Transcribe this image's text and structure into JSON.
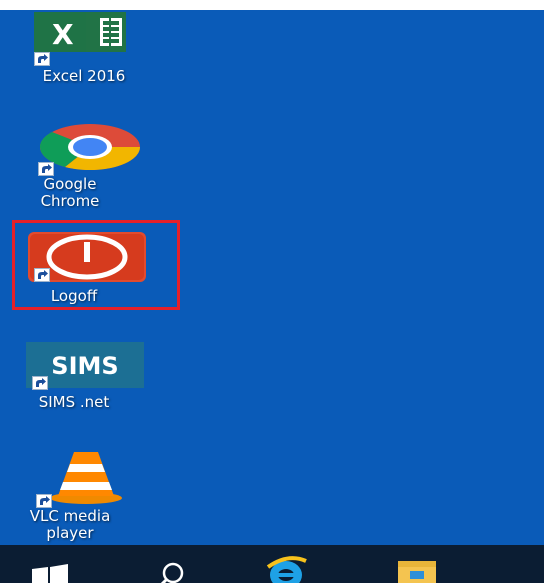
{
  "desktop": {
    "background_color": "#0a5bb8",
    "icons": [
      {
        "label": "Excel 2016",
        "icon": "excel-icon",
        "shortcut": true
      },
      {
        "label": "Google\nChrome",
        "icon": "chrome-icon",
        "shortcut": true
      },
      {
        "label": "Logoff",
        "icon": "power-icon",
        "shortcut": true,
        "selected": true
      },
      {
        "label": "SIMS .net",
        "icon": "sims-icon",
        "icon_text": "SIMS",
        "shortcut": true
      },
      {
        "label": "VLC media\nplayer",
        "icon": "vlc-cone-icon",
        "shortcut": true
      }
    ],
    "highlight_color": "#e5202a"
  },
  "taskbar": {
    "background_color": "#0b1d33",
    "items": [
      {
        "name": "start",
        "icon": "windows-logo-icon"
      },
      {
        "name": "search",
        "icon": "search-icon"
      },
      {
        "name": "internet-explorer",
        "icon": "internet-explorer-icon"
      },
      {
        "name": "file-explorer",
        "icon": "folder-icon"
      }
    ]
  }
}
